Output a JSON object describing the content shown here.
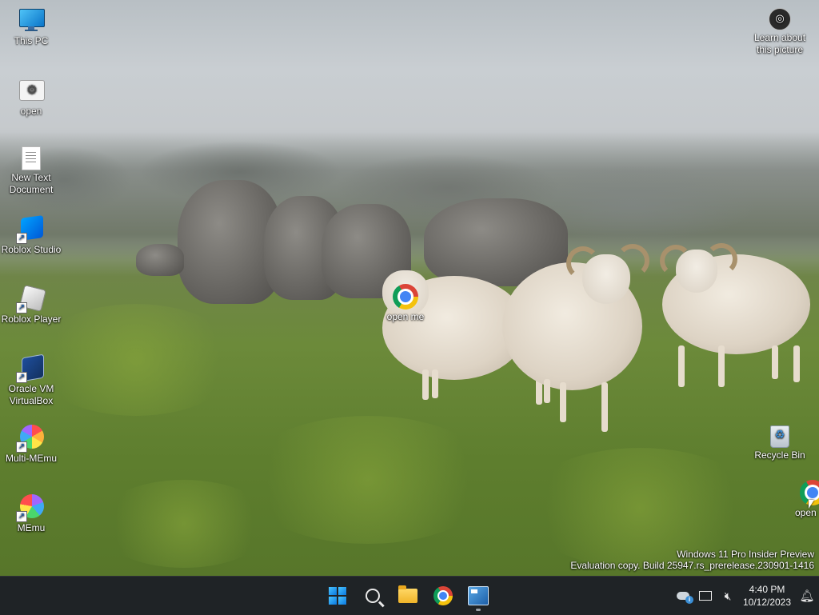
{
  "desktop": {
    "left_icons": [
      {
        "label": "This PC"
      },
      {
        "label": "open"
      },
      {
        "label": "New Text Document"
      },
      {
        "label": "Roblox Studio"
      },
      {
        "label": "Roblox Player"
      },
      {
        "label": "Oracle VM VirtualBox"
      },
      {
        "label": "Multi-MEmu"
      },
      {
        "label": "MEmu"
      }
    ],
    "center_icon": {
      "label": "open me"
    },
    "right_icons": {
      "learn": {
        "label": "Learn about this picture"
      },
      "recycle": {
        "label": "Recycle Bin"
      },
      "partial_open": {
        "label": "open"
      }
    }
  },
  "watermark": {
    "line1": "Windows 11 Pro Insider Preview",
    "line2": "Evaluation copy. Build 25947.rs_prerelease.230901-1416"
  },
  "taskbar": {
    "apps": [
      "start",
      "search",
      "file-explorer",
      "chrome",
      "app"
    ],
    "clock": {
      "time": "4:40 PM",
      "date": "10/12/2023"
    }
  },
  "colors": {
    "taskbar": "#1f2326",
    "accent": "#0a78e0"
  }
}
